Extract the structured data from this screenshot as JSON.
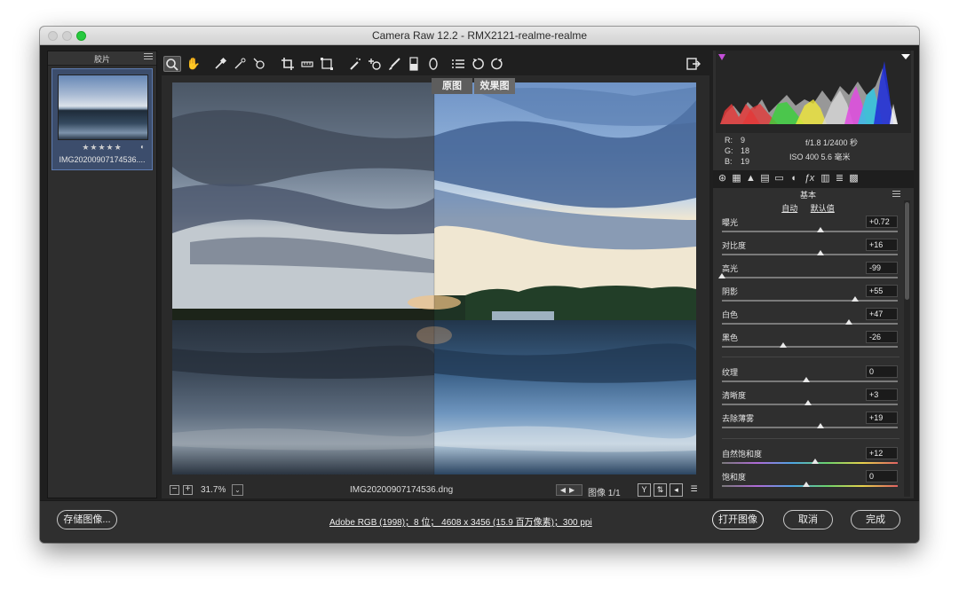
{
  "window": {
    "title": "Camera Raw 12.2 -  RMX2121-realme-realme"
  },
  "filmstrip": {
    "title": "胶片",
    "thumbnail": {
      "rating": "★★★★★",
      "name": "IMG20200907174536...."
    }
  },
  "preview": {
    "before_label": "原图",
    "after_label": "效果图",
    "zoom": "31.7%",
    "file_name": "IMG20200907174536.dng",
    "image_count": "图像 1/1"
  },
  "histogram_info": {
    "r_label": "R:",
    "r_value": "9",
    "g_label": "G:",
    "g_value": "18",
    "b_label": "B:",
    "b_value": "19",
    "aperture_shutter": "f/1.8   1/2400 秒",
    "iso_focal": "ISO 400   5.6 毫米"
  },
  "basic_panel": {
    "title": "基本",
    "auto_link": "自动",
    "default_link": "默认值",
    "sliders": [
      {
        "label": "曝光",
        "value": "+0.72",
        "pos": 0.56
      },
      {
        "label": "对比度",
        "value": "+16",
        "pos": 0.56
      },
      {
        "label": "高光",
        "value": "-99",
        "pos": 0.0
      },
      {
        "label": "阴影",
        "value": "+55",
        "pos": 0.76
      },
      {
        "label": "白色",
        "value": "+47",
        "pos": 0.72
      },
      {
        "label": "黑色",
        "value": "-26",
        "pos": 0.35
      },
      {
        "label": "纹理",
        "value": "0",
        "pos": 0.48
      },
      {
        "label": "清晰度",
        "value": "+3",
        "pos": 0.49
      },
      {
        "label": "去除薄雾",
        "value": "+19",
        "pos": 0.56
      },
      {
        "label": "自然饱和度",
        "value": "+12",
        "pos": 0.53
      },
      {
        "label": "饱和度",
        "value": "0",
        "pos": 0.48
      }
    ]
  },
  "bottom_bar": {
    "save_button": "存储图像...",
    "workflow_text": "Adobe RGB (1998)；8 位；  4608 x 3456 (15.9 百万像素)；300 ppi",
    "open_button": "打开图像",
    "cancel_button": "取消",
    "done_button": "完成"
  },
  "colors": {
    "accent": "#5d7bb0",
    "panel_bg": "#2f2f2f",
    "window_bg": "#1f1f1f",
    "highlight_clip": "#ffffff",
    "shadow_clip": "#c44fd8"
  }
}
